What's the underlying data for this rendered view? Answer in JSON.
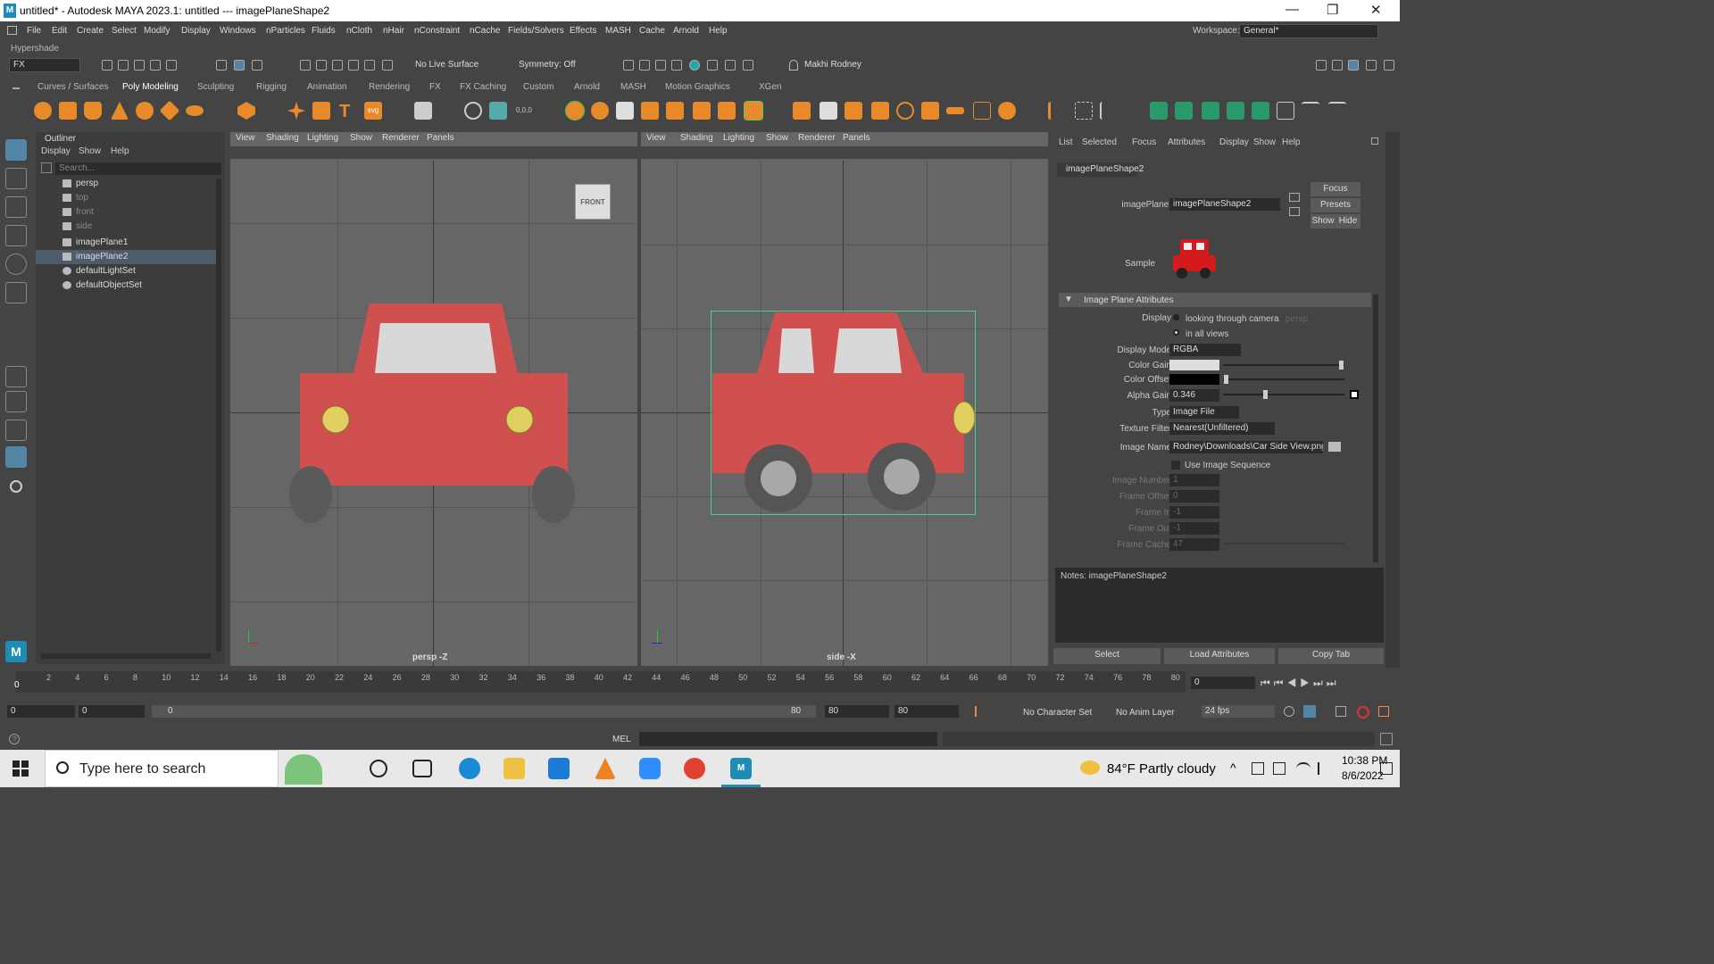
{
  "window": {
    "title": "untitled* - Autodesk MAYA 2023.1: untitled   ---   imagePlaneShape2",
    "minimize": "—",
    "restore": "❐",
    "close": "✕"
  },
  "menubar": [
    "File",
    "Edit",
    "Create",
    "Select",
    "Modify",
    "Display",
    "Windows",
    "nParticles",
    "Fluids",
    "nCloth",
    "nHair",
    "nConstraint",
    "nCache",
    "Fields/Solvers",
    "Effects",
    "MASH",
    "Cache",
    "Arnold",
    "Help"
  ],
  "workspace": {
    "label": "Workspace:",
    "value": "General*"
  },
  "hypershade": "Hypershade",
  "statusline": {
    "menuset": "FX",
    "live_surface": "No Live Surface",
    "symmetry": "Symmetry: Off",
    "user": "Makhi Rodney"
  },
  "shelf_tabs": [
    "Curves / Surfaces",
    "Poly Modeling",
    "Sculpting",
    "Rigging",
    "Animation",
    "Rendering",
    "FX",
    "FX Caching",
    "Custom",
    "Arnold",
    "MASH",
    "Motion Graphics",
    "XGen"
  ],
  "outliner": {
    "title": "Outliner",
    "menus": [
      "Display",
      "Show",
      "Help"
    ],
    "search_placeholder": "Search...",
    "items": [
      {
        "label": "persp"
      },
      {
        "label": "top"
      },
      {
        "label": "front"
      },
      {
        "label": "side"
      },
      {
        "label": "imagePlane1"
      },
      {
        "label": "imagePlane2"
      },
      {
        "label": "defaultLightSet"
      },
      {
        "label": "defaultObjectSet"
      }
    ]
  },
  "viewport_menus": [
    "View",
    "Shading",
    "Lighting",
    "Show",
    "Renderer",
    "Panels"
  ],
  "viewport1": {
    "label": "persp -Z",
    "cube": "FRONT"
  },
  "viewport2": {
    "label": "side -X"
  },
  "attr": {
    "menus": [
      "List",
      "Selected",
      "Focus",
      "Attributes",
      "Display",
      "Show",
      "Help"
    ],
    "tab": "imagePlaneShape2",
    "image_plane_label": "imagePlane:",
    "image_plane_value": "imagePlaneShape2",
    "focus": "Focus",
    "presets": "Presets",
    "show": "Show",
    "hide": "Hide",
    "sample": "Sample",
    "section": "Image Plane Attributes",
    "display_label": "Display",
    "display_opt1": "looking through camera",
    "display_opt1_cam": "persp",
    "display_opt2": "in all views",
    "display_mode_label": "Display Mode",
    "display_mode": "RGBA",
    "color_gain_label": "Color Gain",
    "color_offset_label": "Color Offset",
    "alpha_gain_label": "Alpha Gain",
    "alpha_gain": "0.346",
    "type_label": "Type",
    "type": "Image File",
    "texture_filter_label": "Texture Filter",
    "texture_filter": "Nearest(Unfiltered)",
    "image_name_label": "Image Name",
    "image_name": "Rodney\\Downloads\\Car Side View.png",
    "use_seq": "Use Image Sequence",
    "image_number_label": "Image Number",
    "image_number": "1",
    "frame_offset_label": "Frame Offset",
    "frame_offset": "0",
    "frame_in_label": "Frame In",
    "frame_in": "-1",
    "frame_out_label": "Frame Out",
    "frame_out": "-1",
    "frame_cache_label": "Frame Cache",
    "frame_cache": "47",
    "notes": "Notes:  imagePlaneShape2",
    "select": "Select",
    "load": "Load Attributes",
    "copy": "Copy Tab"
  },
  "timeline": {
    "ticks": [
      "2",
      "4",
      "6",
      "8",
      "10",
      "12",
      "14",
      "16",
      "18",
      "20",
      "22",
      "24",
      "26",
      "28",
      "30",
      "32",
      "34",
      "36",
      "38",
      "40",
      "42",
      "44",
      "46",
      "48",
      "50",
      "52",
      "54",
      "56",
      "58",
      "60",
      "62",
      "64",
      "66",
      "68",
      "70",
      "72",
      "74",
      "76",
      "78",
      "80"
    ],
    "current": "0",
    "frame_field": "0"
  },
  "range": {
    "start": "0",
    "inner_start": "0",
    "slider_start": "0",
    "slider_end": "80",
    "end_inner": "80",
    "end": "80",
    "char_set": "No Character Set",
    "anim_layer": "No Anim Layer",
    "fps": "24 fps"
  },
  "cmdline": {
    "lang": "MEL"
  },
  "taskbar": {
    "search": "Type here to search",
    "weather": "84°F  Partly cloudy",
    "time": "10:38 PM",
    "date": "8/6/2022"
  },
  "colors": {
    "car_red": "#d05050",
    "window_grey": "#d8d8d8",
    "headlight": "#e0d060",
    "wheel": "#5a5a5a"
  }
}
